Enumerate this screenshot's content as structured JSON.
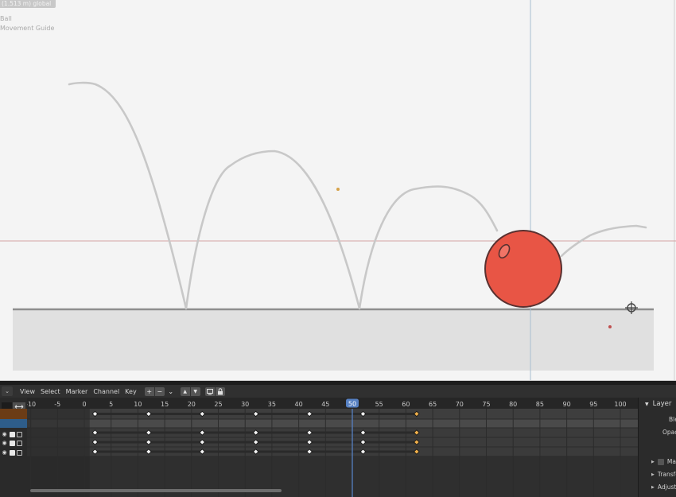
{
  "viewport": {
    "title": "(1.513 m) global",
    "layer_labels": [
      "Ball",
      "Movement Guide"
    ],
    "ball_color": "#e85545",
    "ground_color": "#e0e0e0",
    "guide_color": "#c8c8c8"
  },
  "dopesheet": {
    "editor_icon": "chevron-down-icon",
    "menus": [
      "View",
      "Select",
      "Marker",
      "Channel",
      "Key"
    ],
    "buttons": [
      "+",
      "−",
      "⌄"
    ],
    "nav_buttons": [
      "▲",
      "▼"
    ],
    "current_frame": "50",
    "ruler_labels": [
      "-10",
      "-5",
      "0",
      "5",
      "10",
      "15",
      "20",
      "25",
      "30",
      "35",
      "40",
      "45",
      "50",
      "55",
      "60",
      "65",
      "70",
      "75",
      "80",
      "85",
      "90",
      "95",
      "100"
    ],
    "keyframes": [
      2,
      12,
      22,
      32,
      42,
      52,
      62
    ],
    "selected_keyframe": 62,
    "colors": {
      "summary_channel": "#6b3c16",
      "object_channel": "#2e5d8a",
      "current_frame_indicator": "#5680c2",
      "selected_key": "#f0b04b"
    }
  },
  "sidebar": {
    "title": "Layer",
    "fields": [
      "Blend",
      "Opacity"
    ],
    "panels": [
      "Masks",
      "Transform",
      "Adjustments"
    ]
  }
}
